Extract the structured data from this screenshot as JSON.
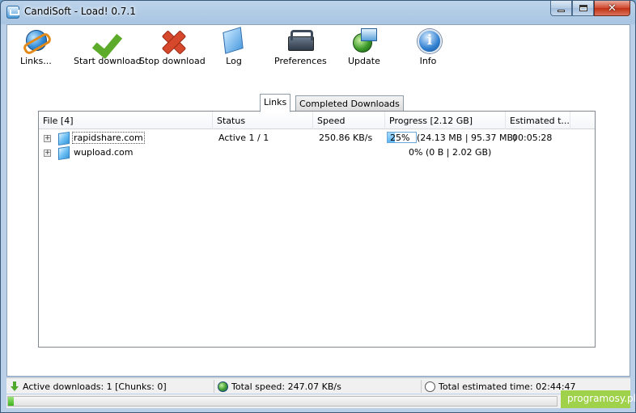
{
  "window": {
    "title": "CandiSoft - Load! 0.7.1",
    "close_glyph": "✕"
  },
  "toolbar": {
    "links_label": "Links...",
    "start_label": "Start download",
    "stop_label": "Stop download",
    "log_label": "Log",
    "preferences_label": "Preferences",
    "update_label": "Update",
    "info_label": "Info"
  },
  "tabs": {
    "links": "Links",
    "completed": "Completed Downloads"
  },
  "table": {
    "headers": {
      "file": "File [4]",
      "status": "Status",
      "speed": "Speed",
      "progress": "Progress [2.12 GB]",
      "estimated": "Estimated t..."
    },
    "rows": [
      {
        "expander": "+",
        "host": "rapidshare.com",
        "status": "Active 1 / 1",
        "speed": "250.86 KB/s",
        "progress_percent": "25%",
        "progress_value": 0.25,
        "progress_detail": "(24.13 MB | 95.37 MB)",
        "estimated": "00:05:28"
      },
      {
        "expander": "+",
        "host": "wupload.com",
        "status": "",
        "speed": "",
        "progress_text": "0% (0 B | 2.02 GB)",
        "estimated": ""
      }
    ]
  },
  "statusbar": {
    "active_downloads": "Active downloads: 1 [Chunks: 0]",
    "total_speed": "Total speed: 247.07 KB/s",
    "total_estimated": "Total estimated time: 02:44:47"
  },
  "overall_progress": 0.01,
  "watermark": "programosy.pl"
}
